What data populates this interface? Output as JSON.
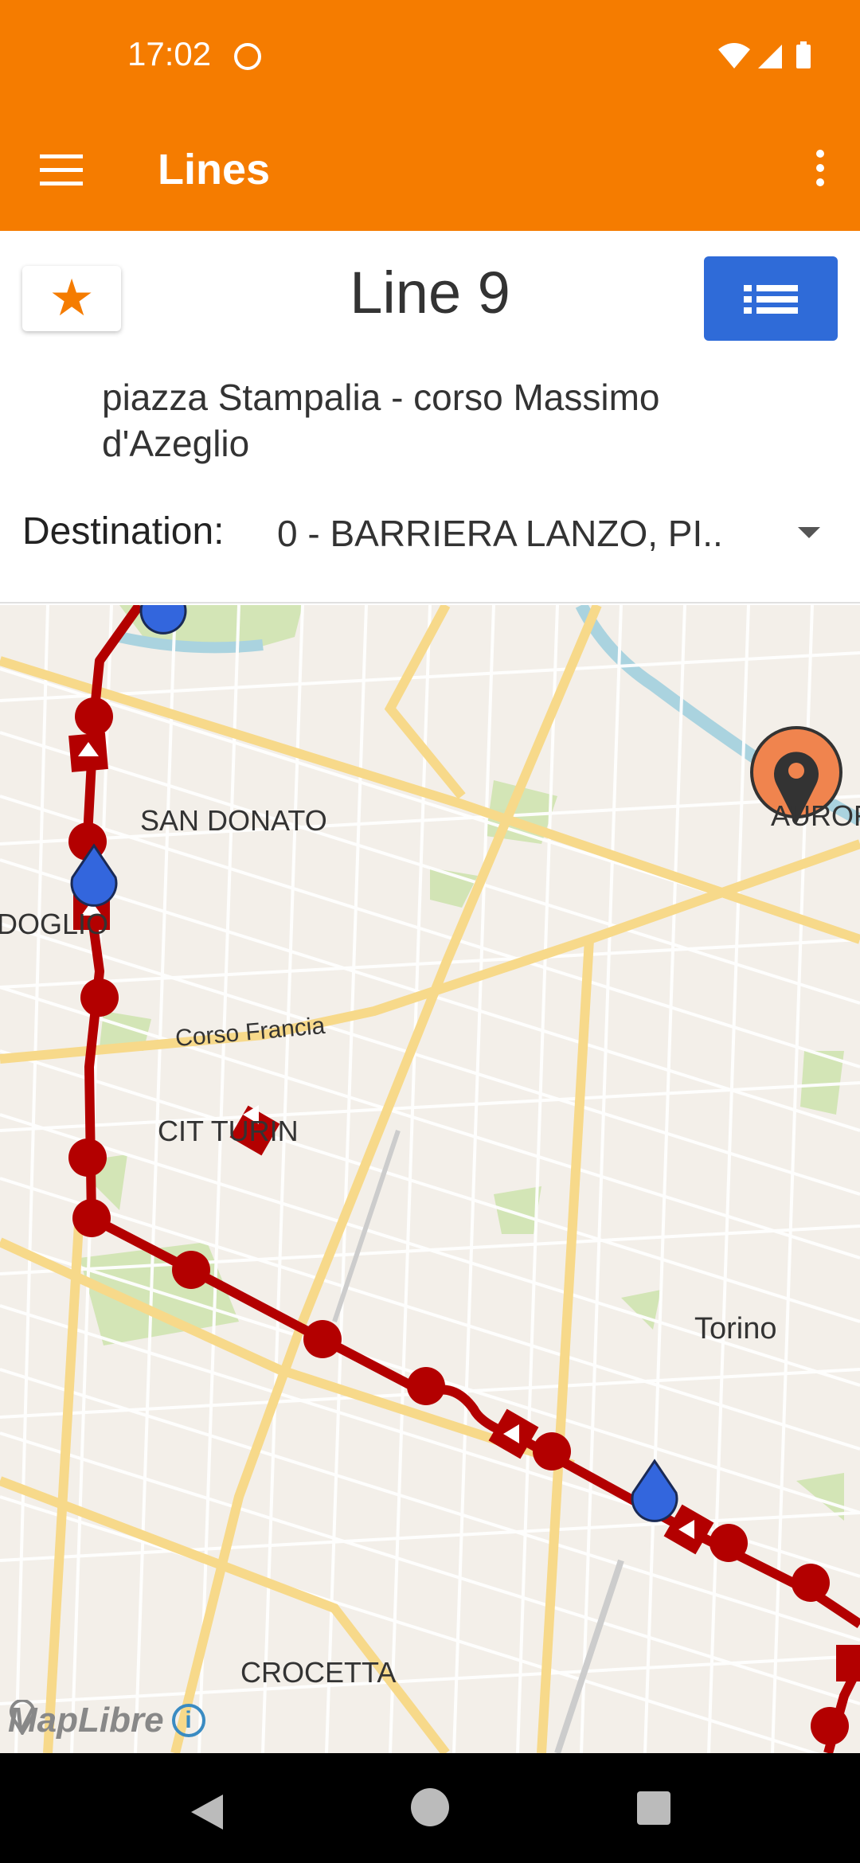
{
  "status_bar": {
    "time": "17:02"
  },
  "app_bar": {
    "title": "Lines"
  },
  "line": {
    "title": "Line 9",
    "route": "piazza Stampalia - corso Massimo d'Azeglio",
    "destination_label": "Destination:",
    "destination_value": "0 - BARRIERA LANZO, PI.."
  },
  "map": {
    "labels": {
      "san_donato": "SAN DONATO",
      "doglio": "IDOGLIO",
      "corso_francia": "Corso Francia",
      "cit_turin": "CIT TURIN",
      "torino": "Torino",
      "crocetta": "CROCETTA",
      "aurora": "AURORA"
    },
    "attribution": "MapLibre",
    "colors": {
      "route": "#b30000",
      "vehicle": "#3366dd",
      "user_marker": "#f0844e"
    }
  }
}
